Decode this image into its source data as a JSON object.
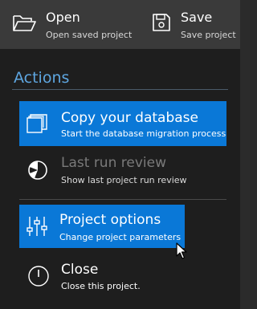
{
  "toolbar": {
    "open": {
      "label": "Open",
      "sublabel": "Open saved project",
      "icon": "folder-open-icon"
    },
    "save": {
      "label": "Save",
      "sublabel": "Save project",
      "icon": "floppy-disk-icon"
    }
  },
  "actions": {
    "title": "Actions",
    "items": [
      {
        "label": "Copy your database",
        "sublabel": "Start the database migration process",
        "icon": "copy-icon",
        "state": "selected"
      },
      {
        "label": "Last run review",
        "sublabel": "Show last project run review",
        "icon": "pie-chart-icon",
        "state": "disabled"
      },
      {
        "label": "Project options",
        "sublabel": "Change project parameters",
        "icon": "sliders-icon",
        "state": "hover"
      },
      {
        "label": "Close",
        "sublabel": "Close this project.",
        "icon": "power-icon",
        "state": "normal"
      }
    ]
  },
  "colors": {
    "accent": "#0a78d7",
    "title": "#5ea6e0",
    "panel_bg": "#1e1e1e",
    "toolbar_bg": "#3a3a3a"
  }
}
